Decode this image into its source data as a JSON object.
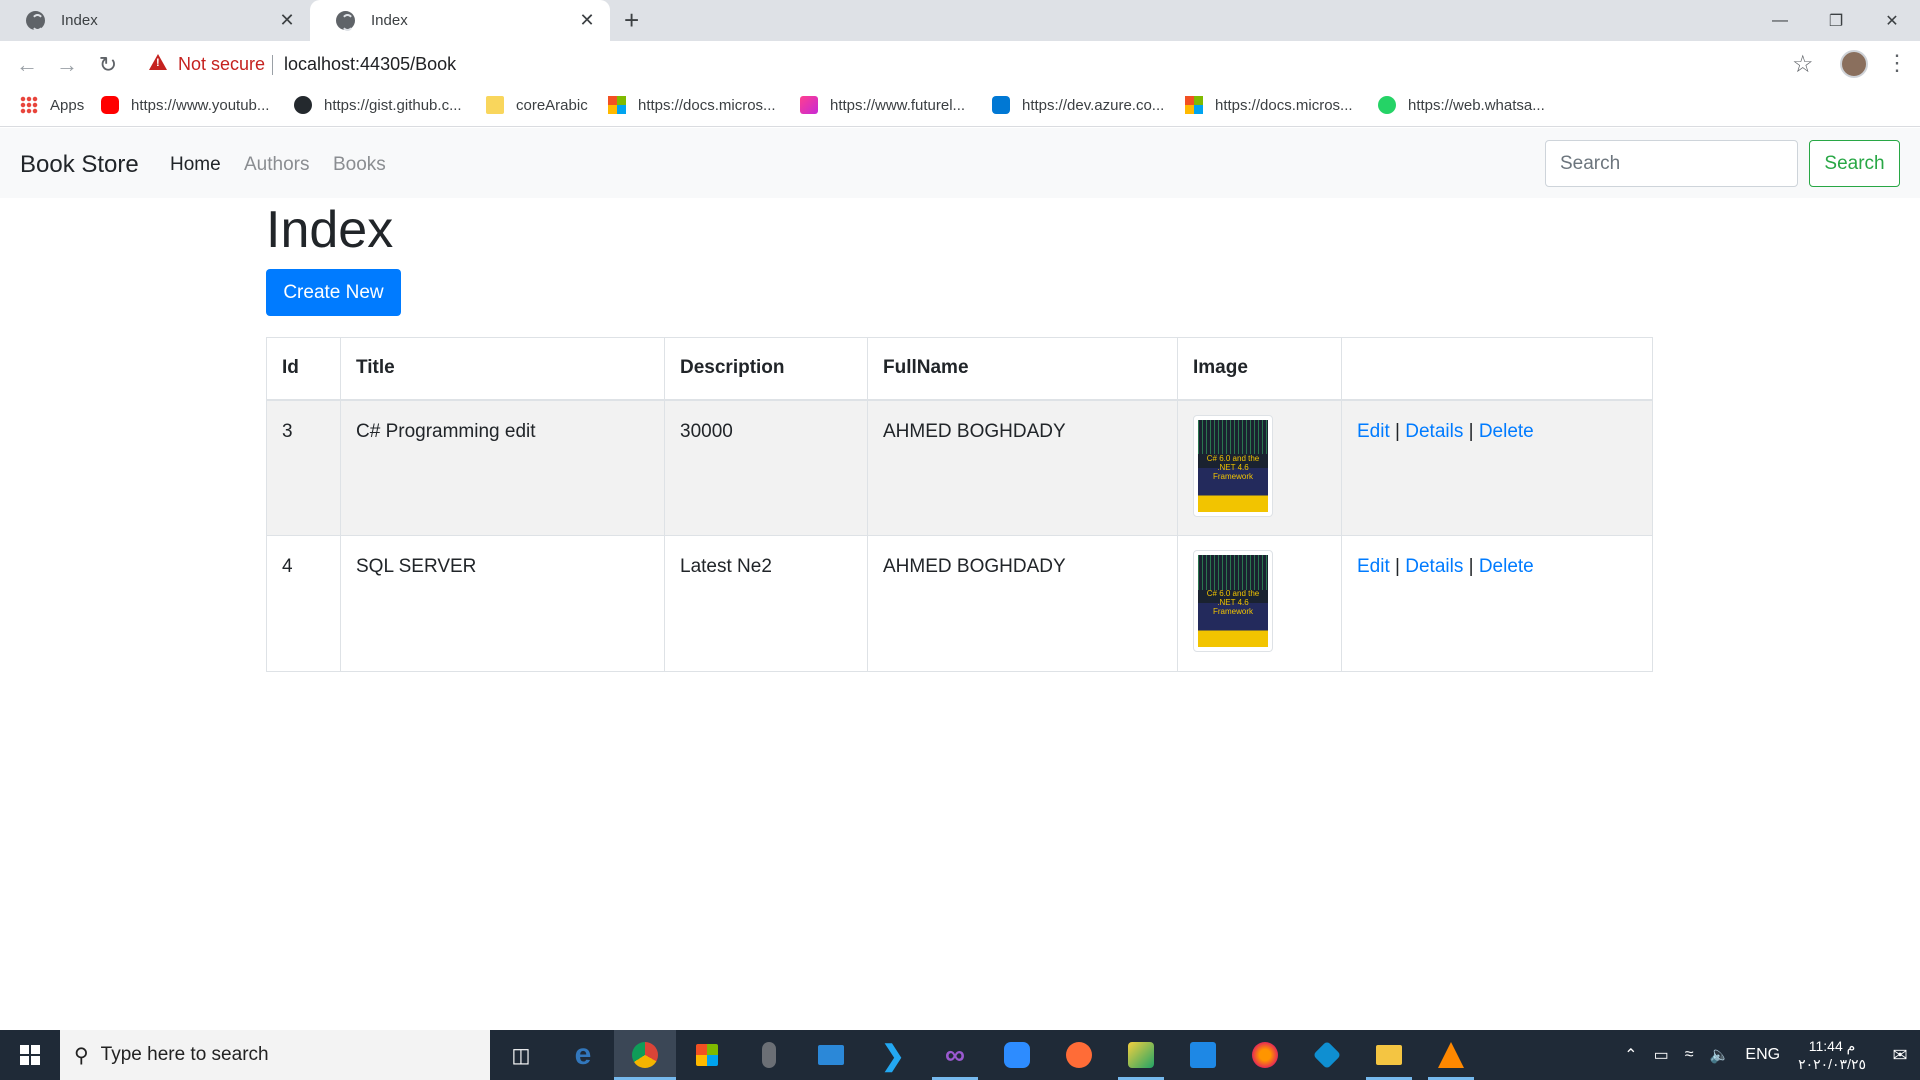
{
  "browser": {
    "tabs": [
      {
        "title": "Index"
      },
      {
        "title": "Index"
      }
    ],
    "security_label": "Not secure",
    "url": "localhost:44305/Book",
    "bookmarks": [
      {
        "label": "Apps",
        "icon": "apps-grid-icon"
      },
      {
        "label": "https://www.youtub...",
        "icon": "youtube-icon"
      },
      {
        "label": "https://gist.github.c...",
        "icon": "github-icon"
      },
      {
        "label": "coreArabic",
        "icon": "folder-icon"
      },
      {
        "label": "https://docs.micros...",
        "icon": "microsoft-icon"
      },
      {
        "label": "https://www.futurel...",
        "icon": "futurelearn-icon"
      },
      {
        "label": "https://dev.azure.co...",
        "icon": "azure-devops-icon"
      },
      {
        "label": "https://docs.micros...",
        "icon": "microsoft-icon"
      },
      {
        "label": "https://web.whatsa...",
        "icon": "whatsapp-icon"
      }
    ]
  },
  "navbar": {
    "brand": "Book Store",
    "links": [
      {
        "label": "Home",
        "active": true
      },
      {
        "label": "Authors",
        "active": false
      },
      {
        "label": "Books",
        "active": false
      }
    ],
    "search_placeholder": "Search",
    "search_button": "Search"
  },
  "page": {
    "title": "Index",
    "create_button": "Create New",
    "table": {
      "headers": [
        "Id",
        "Title",
        "Description",
        "FullName",
        "Image",
        ""
      ],
      "rows": [
        {
          "id": "3",
          "title": "C# Programming edit",
          "description": "30000",
          "fullname": "AHMED BOGHDADY",
          "cover_text": "C# 6.0 and the .NET 4.6 Framework",
          "actions": [
            "Edit",
            "Details",
            "Delete"
          ]
        },
        {
          "id": "4",
          "title": "SQL SERVER",
          "description": "Latest Ne2",
          "fullname": "AHMED BOGHDADY",
          "cover_text": "C# 6.0 and the .NET 4.6 Framework",
          "actions": [
            "Edit",
            "Details",
            "Delete"
          ]
        }
      ],
      "action_separator": "|"
    }
  },
  "taskbar": {
    "search_placeholder": "Type here to search",
    "language": "ENG",
    "time": "11:44 م",
    "date": "٢٠٢٠/٠٣/٢٥"
  },
  "colors": {
    "primary": "#007bff",
    "success": "#28a745",
    "navbar_bg": "#f8f9fa",
    "danger": "#c5221f"
  }
}
